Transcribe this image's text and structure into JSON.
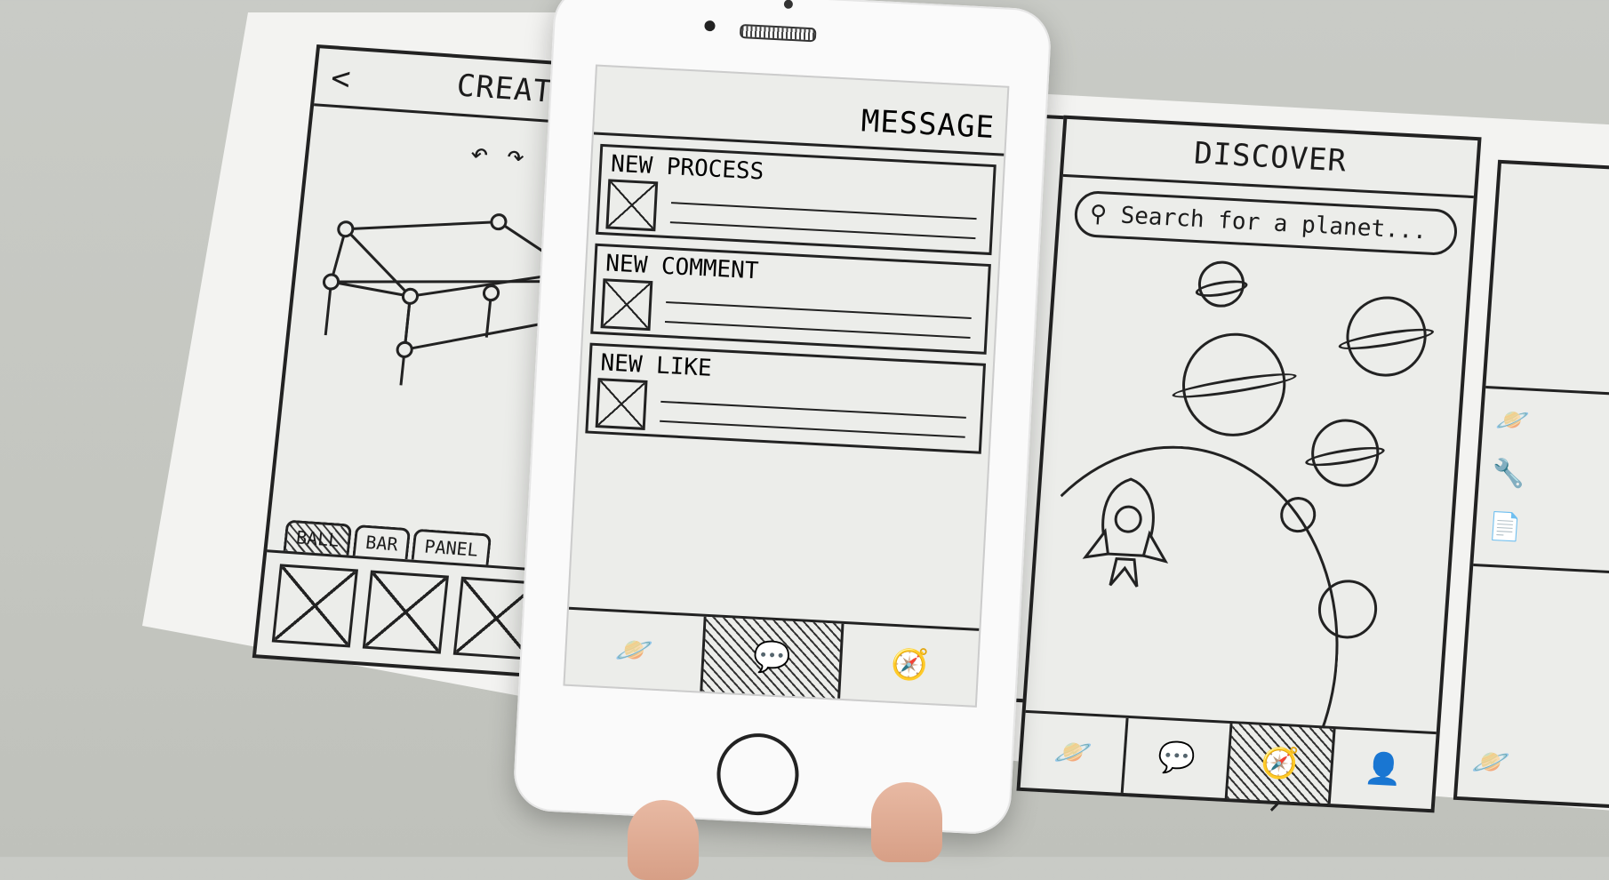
{
  "creat_screen": {
    "title": "CREAT",
    "back": "<",
    "undo_redo": "↶ ↷",
    "tabs": [
      "BALL",
      "BAR",
      "PANEL"
    ]
  },
  "message_screen": {
    "title": "MESSAGE",
    "items": [
      {
        "label": "NEW PROCESS"
      },
      {
        "label": "NEW COMMENT"
      },
      {
        "label": "NEW LIKE"
      }
    ]
  },
  "discover_screen": {
    "title": "DISCOVER",
    "search_placeholder": "Search for a planet..."
  },
  "icons": {
    "planet": "🪐",
    "chat": "💬",
    "compass": "🧭",
    "person": "👤",
    "trash": "🗑",
    "check": "✓",
    "wrench": "🔧",
    "doc": "📄"
  }
}
